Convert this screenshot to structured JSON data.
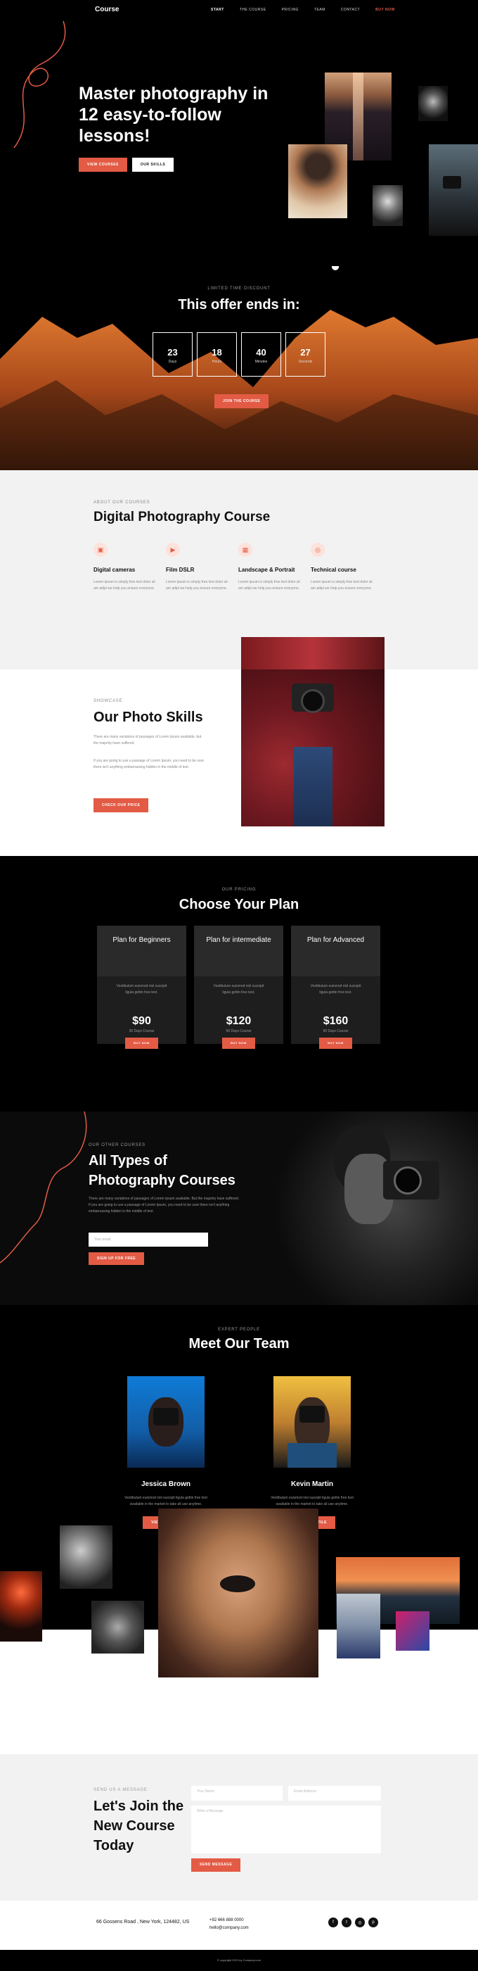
{
  "nav": {
    "logo": "Course",
    "items": [
      "START",
      "THE COURSE",
      "PRICING",
      "TEAM",
      "CONTACT"
    ],
    "buy": "BUY NOW"
  },
  "hero": {
    "title": "Master photography in 12 easy-to-follow lessons!",
    "view_courses": "VIEW COURSES",
    "our_skills": "OUR SKILLS"
  },
  "offer": {
    "kicker": "LIMITED TIME DISCOUNT",
    "title": "This offer ends in:",
    "counters": [
      {
        "value": "23",
        "label": "Days"
      },
      {
        "value": "18",
        "label": "Hours"
      },
      {
        "value": "40",
        "label": "Minutes"
      },
      {
        "value": "27",
        "label": "Seconds"
      }
    ],
    "button": "JOIN THE COURSE"
  },
  "about": {
    "kicker": "ABOUT OUR COURSES",
    "title": "Digital Photography Course",
    "features": [
      {
        "icon": "camera-icon",
        "title": "Digital cameras",
        "text": "Lorem ipsum is simply free text dolor sit am adipi we help you ensure everyone."
      },
      {
        "icon": "film-icon",
        "title": "Film DSLR",
        "text": "Lorem ipsum is simply free text dolor sit am adipi we help you ensure everyone."
      },
      {
        "icon": "image-icon",
        "title": "Landscape & Portrait",
        "text": "Lorem ipsum is simply free text dolor sit am adipi we help you ensure everyone."
      },
      {
        "icon": "target-icon",
        "title": "Technical course",
        "text": "Lorem ipsum is simply free text dolor sit am adipi we help you ensure everyone."
      }
    ]
  },
  "skills": {
    "kicker": "SHOWCASE",
    "title": "Our Photo Skills",
    "p1": "There are many variations of passages of Lorem Ipsum available, but the majority have suffered.",
    "p2": "If you are going to use a passage of Lorem Ipsum, you need to be sure there isn't anything embarrassing hidden in the middle of text.",
    "button": "CHECK OUR PRICE"
  },
  "pricing": {
    "kicker": "OUR PRICING",
    "title": "Choose Your Plan",
    "plans": [
      {
        "name": "Plan for Beginners",
        "desc": "Vestibulum euismod nisl suscipit ligula gettin free text.",
        "price": "$90",
        "sub": "30 Days Course",
        "button": "BUY NOW"
      },
      {
        "name": "Plan for intermediate",
        "desc": "Vestibulum euismod nisl suscipit ligula gettin free text.",
        "price": "$120",
        "sub": "60 Days Course",
        "button": "BUY NOW"
      },
      {
        "name": "Plan for Advanced",
        "desc": "Vestibulum euismod nisl suscipit ligula gettin free text.",
        "price": "$160",
        "sub": "90 Days Course",
        "button": "BUY NOW"
      }
    ]
  },
  "courses": {
    "kicker": "OUR OTHER COURSES",
    "title": "All Types of Photography Courses",
    "text": "There are many variations of passages of Lorem Ipsum available. But the majority have suffered. If you are going to use a passage of Lorem Ipsum, you need to be sure there isn't anything embarrassing hidden in the middle of text.",
    "email_placeholder": "Your email",
    "button": "SIGN UP FOR FREE"
  },
  "team": {
    "kicker": "EXPERT PEOPLE",
    "title": "Meet Our Team",
    "members": [
      {
        "name": "Jessica Brown",
        "desc": "Vestibulum euismod nisl suscipit ligula gettin free text available in the market to take all use anytime.",
        "button": "VIEW PROFILE"
      },
      {
        "name": "Kevin Martin",
        "desc": "Vestibulum euismod nisl suscipit ligula gettin free text available in the market to take all use anytime.",
        "button": "VIEW PROFILE"
      }
    ]
  },
  "contact": {
    "kicker": "SEND US A MESSAGE",
    "title": "Let's Join the New Course Today",
    "name_placeholder": "Your Name",
    "email_placeholder": "Email Address",
    "message_placeholder": "Write a Message",
    "button": "SEND MESSAGE"
  },
  "footer": {
    "address": "66 Gossens Road , New York, 124482, US",
    "phone": "+92 666 888 0000",
    "email": "hello@company.com",
    "social": [
      {
        "icon": "facebook-icon",
        "glyph": "f"
      },
      {
        "icon": "twitter-icon",
        "glyph": "t"
      },
      {
        "icon": "instagram-icon",
        "glyph": "◎"
      },
      {
        "icon": "pinterest-icon",
        "glyph": "p"
      }
    ],
    "copyright": "© copyright 2021 by Company.com"
  },
  "colors": {
    "accent": "#e35b45",
    "dark": "#000000",
    "light": "#f2f2f2"
  }
}
